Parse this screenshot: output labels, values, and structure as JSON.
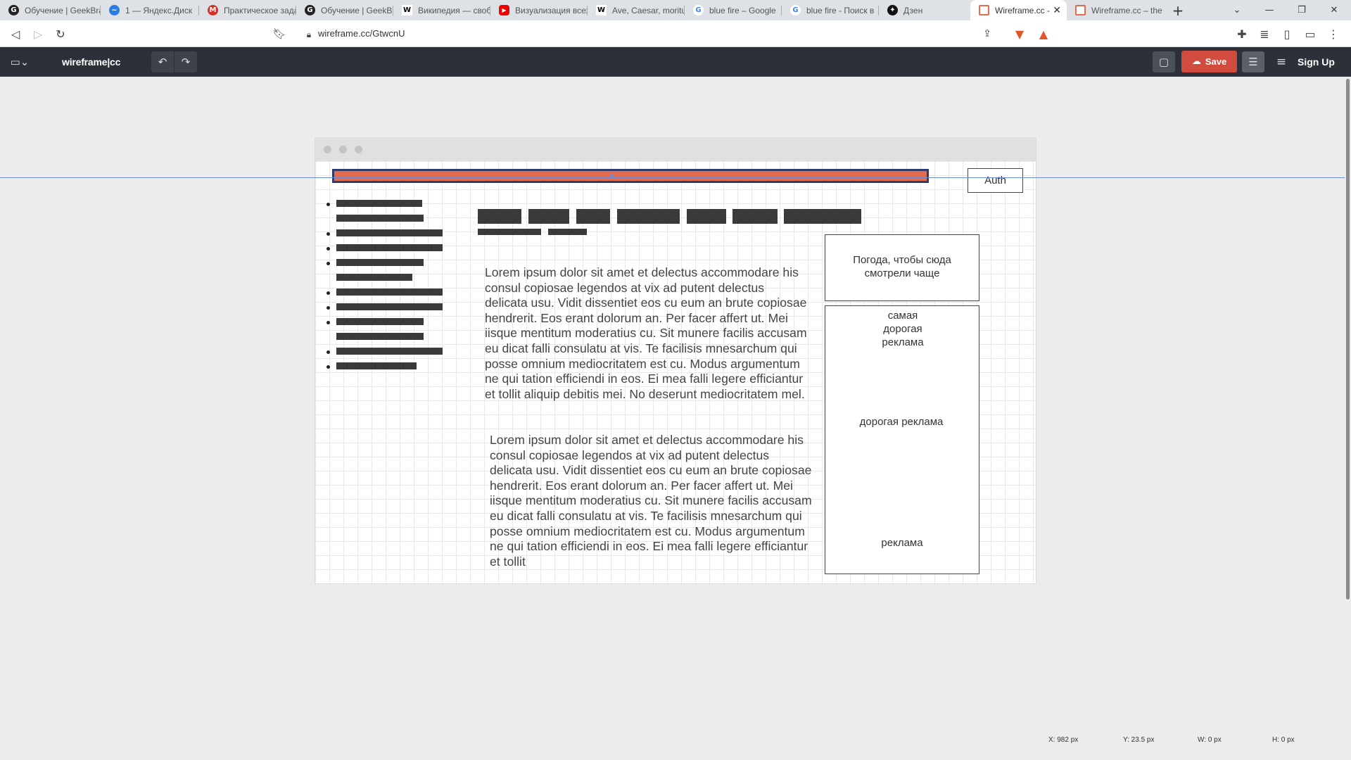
{
  "browser": {
    "tabs": [
      {
        "title": "Обучение | GeekBrains",
        "icon_color": "#222"
      },
      {
        "title": "1 — Яндекс.Диск",
        "icon_color": "#2b7be4"
      },
      {
        "title": "Практическое задание",
        "icon_color": "#d93025"
      },
      {
        "title": "Обучение | GeekBrains",
        "icon_color": "#222"
      },
      {
        "title": "Википедия — свободная",
        "icon_color": "#000"
      },
      {
        "title": "Визуализация всех",
        "icon_color": "#e00"
      },
      {
        "title": "Ave, Caesar, morituri",
        "icon_color": "#000"
      },
      {
        "title": "blue fire – Google",
        "icon_color": "#4285f4"
      },
      {
        "title": "blue fire - Поиск в",
        "icon_color": "#4285f4"
      },
      {
        "title": "Дзен",
        "icon_color": "#000"
      },
      {
        "title": "Wireframe.cc - ",
        "icon_color": "#e36b4f",
        "active": true
      },
      {
        "title": "Wireframe.cc – the",
        "icon_color": "#e36b4f"
      }
    ],
    "new_tab": "+",
    "url": "wireframe.cc/GtwcnU"
  },
  "app": {
    "logo": "wireframe|cc",
    "save_label": "Save",
    "signup_label": "Sign Up"
  },
  "wireframe": {
    "auth_label": "Auth",
    "weather_text": "Погода, чтобы сюда смотрели чаще",
    "ad_top": "самая дорогая реклама",
    "ad_middle": "дорогая реклама",
    "ad_bottom": "реклама",
    "lorem_1": "Lorem ipsum dolor sit amet et delectus accommodare his consul copiosae legendos at vix ad putent delectus delicata usu. Vidit dissentiet eos cu eum an brute copiosae hendrerit. Eos erant dolorum an. Per facer affert ut. Mei iisque mentitum moderatius cu. Sit munere facilis accusam eu dicat falli consulatu at vis. Te facilisis mnesarchum qui posse omnium mediocritatem est cu. Modus argumentum ne qui tation efficiendi in eos. Ei mea falli legere efficiantur et tollit aliquip debitis mei. No deserunt mediocritatem mel.",
    "lorem_2": "Lorem ipsum dolor sit amet et delectus accommodare his consul copiosae legendos at vix ad putent delectus delicata usu. Vidit dissentiet eos cu eum an brute copiosae hendrerit. Eos erant dolorum an. Per facer affert ut. Mei iisque mentitum moderatius cu. Sit munere facilis accusam eu dicat falli consulatu at vis. Te facilisis mnesarchum qui posse omnium mediocritatem est cu. Modus argumentum ne qui tation efficiendi in eos. Ei mea falli legere efficiantur et tollit"
  },
  "statusbar": {
    "x": "X: 982 px",
    "y": "Y: 23.5 px",
    "w": "W: 0 px",
    "h": "H: 0 px"
  }
}
